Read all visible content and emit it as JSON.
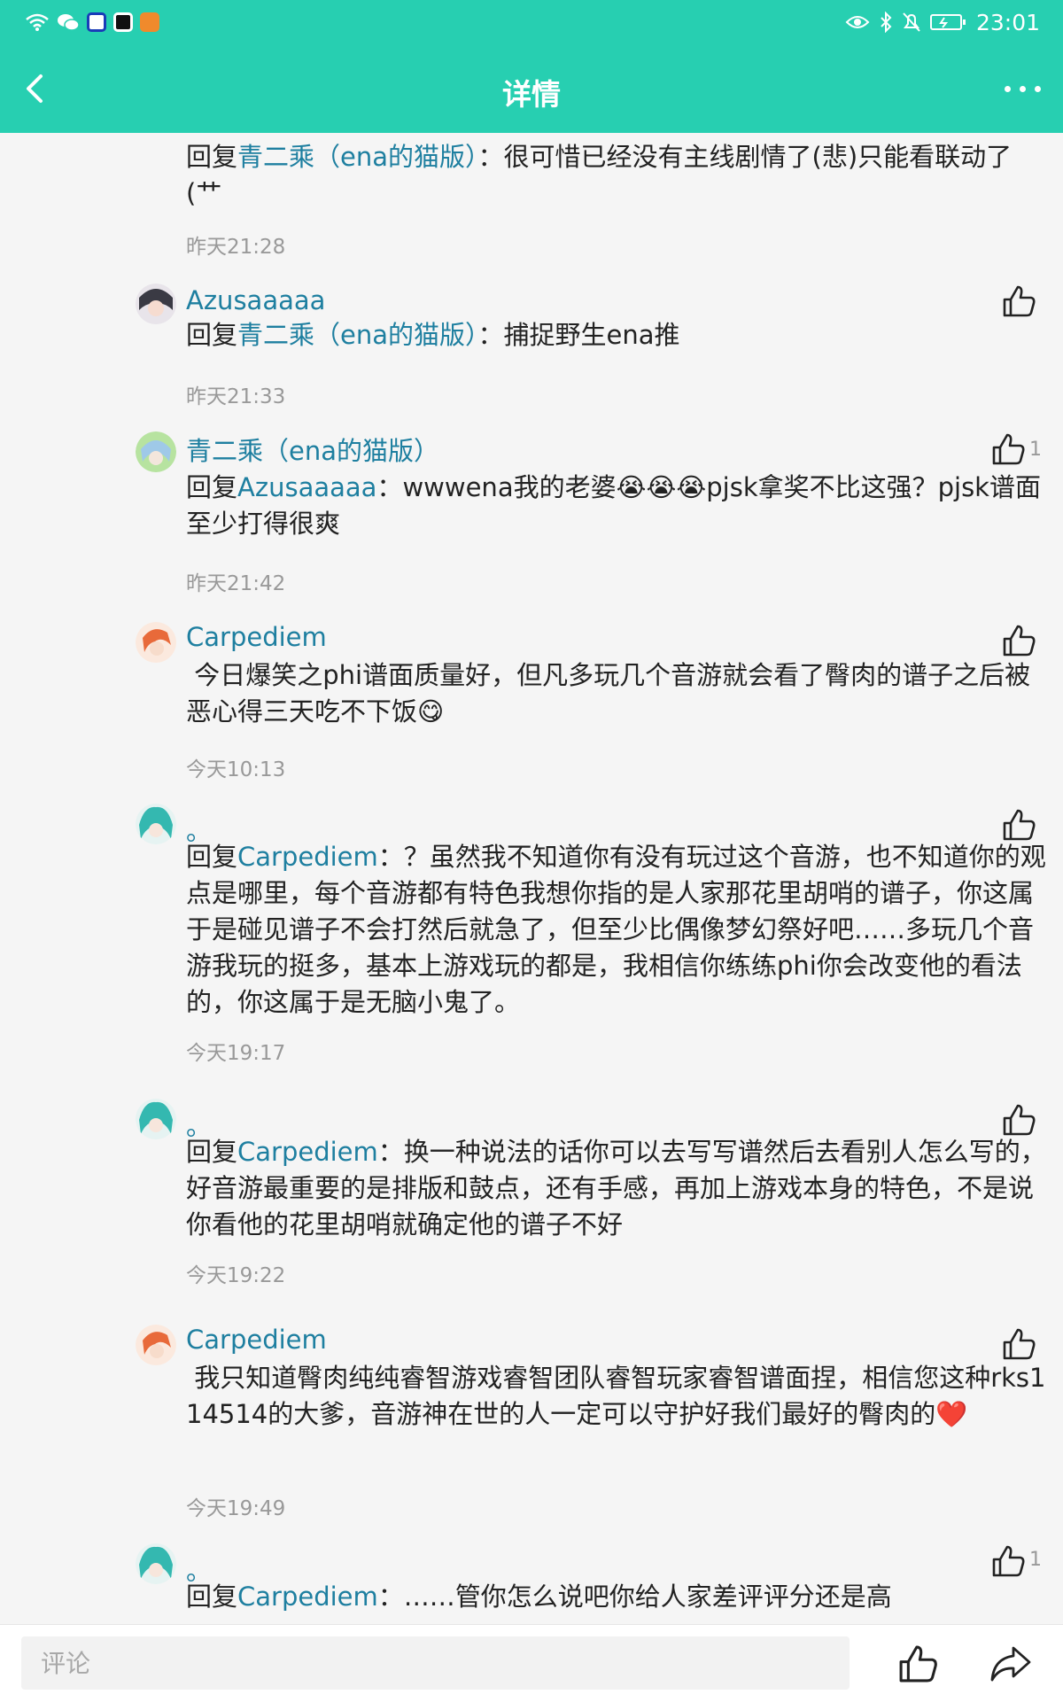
{
  "status_bar": {
    "time": "23:01",
    "left_icons": [
      "wifi-icon",
      "wechat-icon",
      "app-icon-blue",
      "app-icon-black",
      "app-icon-orange"
    ],
    "right_icons": [
      "eye-icon",
      "bluetooth-icon",
      "mute-icon",
      "battery-icon"
    ]
  },
  "header": {
    "title": "详情",
    "back_icon": "chevron-left-icon",
    "more_icon": "more-dots-icon"
  },
  "comments": [
    {
      "name": "",
      "reply_prefix": "回复",
      "reply_target": "青二乘（ena的猫版）",
      "reply_sep": "：",
      "body": "很可惜已经没有主线剧情了(悲)只能看联动了(艹",
      "time": "昨天21:28",
      "likes": ""
    },
    {
      "name": "Azusaaaaa",
      "reply_prefix": "回复",
      "reply_target": "青二乘（ena的猫版）",
      "reply_sep": "：",
      "body": "捕捉野生ena推",
      "time": "昨天21:33",
      "likes": ""
    },
    {
      "name": "青二乘（ena的猫版）",
      "reply_prefix": "回复",
      "reply_target": "Azusaaaaa",
      "reply_sep": "：",
      "body": "wwwena我的老婆😭😭😭pjsk拿奖不比这强？pjsk谱面至少打得很爽",
      "time": "昨天21:42",
      "likes": "1"
    },
    {
      "name": "Carpediem",
      "reply_prefix": "",
      "reply_target": "",
      "reply_sep": "",
      "body": " 今日爆笑之phi谱面质量好，但凡多玩几个音游就会看了臀肉的谱子之后被恶心得三天吃不下饭😋",
      "time": "今天10:13",
      "likes": ""
    },
    {
      "name": "。",
      "reply_prefix": "回复",
      "reply_target": "Carpediem",
      "reply_sep": "：",
      "body": "？虽然我不知道你有没有玩过这个音游，也不知道你的观点是哪里，每个音游都有特色我想你指的是人家那花里胡哨的谱子，你这属于是碰见谱子不会打然后就急了，但至少比偶像梦幻祭好吧……多玩几个音游我玩的挺多，基本上游戏玩的都是，我相信你练练phi你会改变他的看法的，你这属于是无脑小鬼了。",
      "time": "今天19:17",
      "likes": ""
    },
    {
      "name": "。",
      "reply_prefix": "回复",
      "reply_target": "Carpediem",
      "reply_sep": "：",
      "body": "换一种说法的话你可以去写写谱然后去看别人怎么写的，好音游最重要的是排版和鼓点，还有手感，再加上游戏本身的特色，不是说你看他的花里胡哨就确定他的谱子不好",
      "time": "今天19:22",
      "likes": ""
    },
    {
      "name": "Carpediem",
      "reply_prefix": "",
      "reply_target": "",
      "reply_sep": "",
      "body": " 我只知道臀肉纯纯睿智游戏睿智团队睿智玩家睿智谱面捏，相信您这种rks114514的大爹，音游神在世的人一定可以守护好我们最好的臀肉的❤️",
      "time": "今天19:49",
      "likes": ""
    },
    {
      "name": "。",
      "reply_prefix": "回复",
      "reply_target": "Carpediem",
      "reply_sep": "：",
      "body": "……管你怎么说吧你给人家差评评分还是高",
      "time": "",
      "likes": "1"
    }
  ],
  "bottom_bar": {
    "comment_placeholder": "评论",
    "like_icon": "thumbs-up-icon",
    "share_icon": "share-icon"
  },
  "colors": {
    "accent": "#27cfb1",
    "link": "#1e7fa0",
    "meta": "#999999"
  }
}
